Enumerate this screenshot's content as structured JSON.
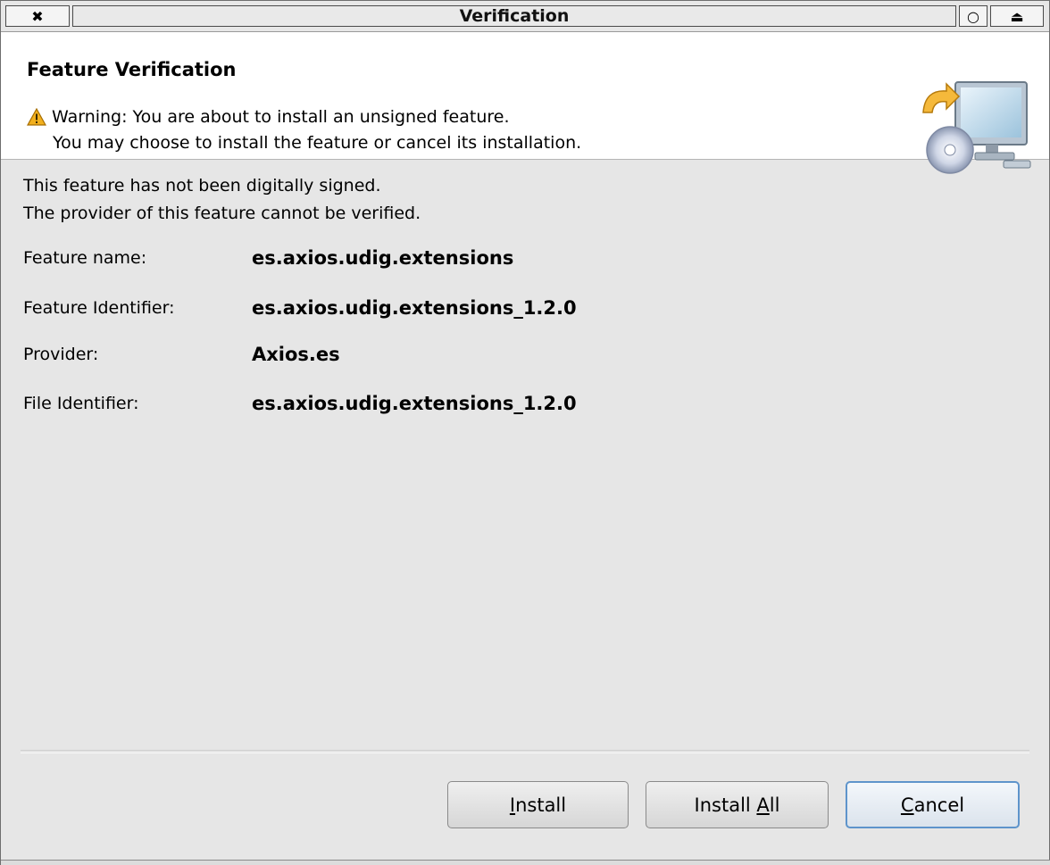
{
  "window": {
    "title": "Verification",
    "close_glyph": "✖",
    "min_glyph": "○",
    "max_glyph": "⏏"
  },
  "header": {
    "title": "Feature Verification",
    "warning_line1": "Warning: You are about to install an unsigned feature.",
    "warning_line2": "You may choose to install the feature or cancel its installation.",
    "icon": "warning-triangle-icon",
    "image": "install-monitor-cd-icon"
  },
  "body": {
    "message_line1": "This feature has not been digitally signed.",
    "message_line2": "The provider of this feature cannot be verified.",
    "fields": [
      {
        "label": "Feature name:",
        "value": "es.axios.udig.extensions"
      },
      {
        "label": "Feature Identifier:",
        "value": "es.axios.udig.extensions_1.2.0"
      },
      {
        "label": "Provider:",
        "value": "Axios.es"
      },
      {
        "label": "File Identifier:",
        "value": "es.axios.udig.extensions_1.2.0"
      }
    ]
  },
  "buttons": {
    "install": {
      "mnemonic": "I",
      "rest": "nstall"
    },
    "install_all": {
      "prefix": "Install ",
      "mnemonic": "A",
      "rest": "ll"
    },
    "cancel": {
      "mnemonic": "C",
      "rest": "ancel"
    }
  },
  "colors": {
    "window_bg": "#e6e6e6",
    "header_bg": "#ffffff",
    "default_button_border": "#5e94cb",
    "warning": "#f2b01e"
  }
}
